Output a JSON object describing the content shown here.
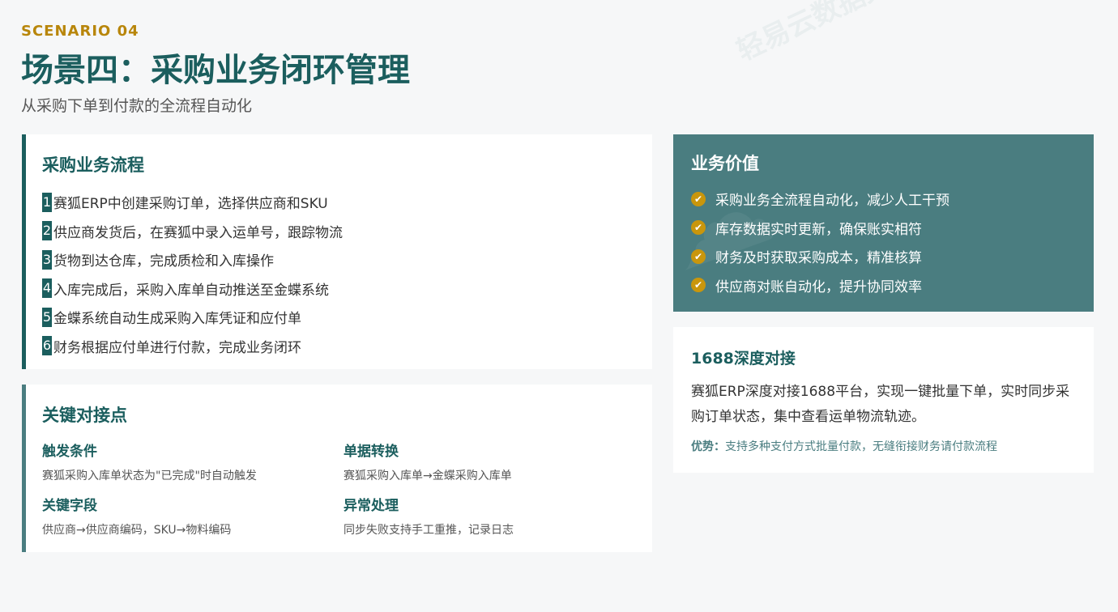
{
  "header": {
    "scenario": "SCENARIO 04",
    "title": "场景四：采购业务闭环管理",
    "subtitle": "从采购下单到付款的全流程自动化",
    "watermark": "轻易云数据集成平台"
  },
  "flow": {
    "title": "采购业务流程",
    "steps": [
      {
        "num": "1",
        "text": "赛狐ERP中创建采购订单，选择供应商和SKU"
      },
      {
        "num": "2",
        "text": "供应商发货后，在赛狐中录入运单号，跟踪物流"
      },
      {
        "num": "3",
        "text": "货物到达仓库，完成质检和入库操作"
      },
      {
        "num": "4",
        "text": "入库完成后，采购入库单自动推送至金蝶系统"
      },
      {
        "num": "5",
        "text": "金蝶系统自动生成采购入库凭证和应付单"
      },
      {
        "num": "6",
        "text": "财务根据应付单进行付款，完成业务闭环"
      }
    ]
  },
  "points": {
    "title": "关键对接点",
    "items": [
      {
        "heading": "触发条件",
        "desc": "赛狐采购入库单状态为\"已完成\"时自动触发"
      },
      {
        "heading": "单据转换",
        "desc": "赛狐采购入库单→金蝶采购入库单"
      },
      {
        "heading": "关键字段",
        "desc": "供应商→供应商编码，SKU→物料编码"
      },
      {
        "heading": "异常处理",
        "desc": "同步失败支持手工重推，记录日志"
      }
    ]
  },
  "value": {
    "title": "业务价值",
    "items": [
      "采购业务全流程自动化，减少人工干预",
      "库存数据实时更新，确保账实相符",
      "财务及时获取采购成本，精准核算",
      "供应商对账自动化，提升协同效率"
    ]
  },
  "alibaba": {
    "title": "1688深度对接",
    "desc": "赛狐ERP深度对接1688平台，实现一键批量下单，实时同步采购订单状态，集中查看运单物流轨迹。",
    "adv_label": "优势：",
    "adv_text": "支持多种支付方式批量付款，无缝衔接财务请付款流程"
  },
  "colors": {
    "primary": "#1b5e5e",
    "accent": "#b8860b",
    "value_bg": "#4a7d80",
    "check": "#c9960c"
  }
}
